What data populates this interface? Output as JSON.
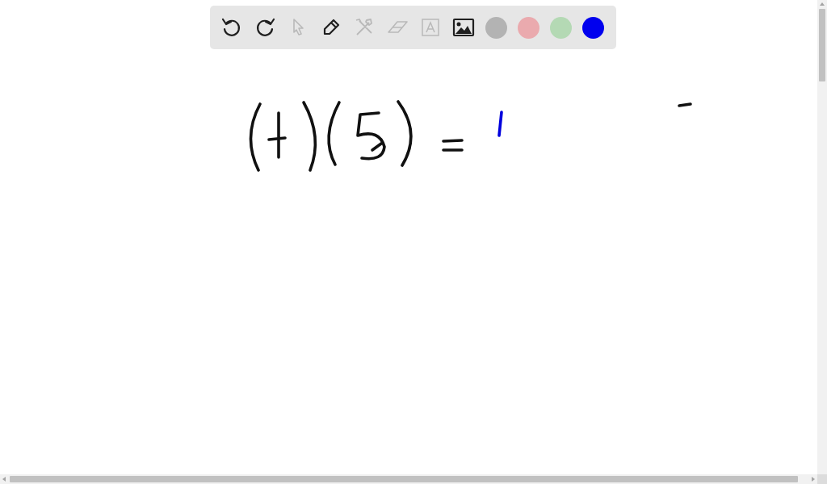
{
  "toolbar": {
    "tools": [
      {
        "kind": "undo",
        "disabled": false
      },
      {
        "kind": "redo",
        "disabled": false
      },
      {
        "kind": "select",
        "disabled": true
      },
      {
        "kind": "pen",
        "disabled": false
      },
      {
        "kind": "tools",
        "disabled": true
      },
      {
        "kind": "eraser",
        "disabled": true
      },
      {
        "kind": "text",
        "disabled": true
      },
      {
        "kind": "image",
        "disabled": false
      }
    ],
    "colors": [
      {
        "color": "#b3b3b3"
      },
      {
        "color": "#eaaaae"
      },
      {
        "color": "#b4d9b4"
      },
      {
        "color": "#0000ee"
      }
    ]
  }
}
